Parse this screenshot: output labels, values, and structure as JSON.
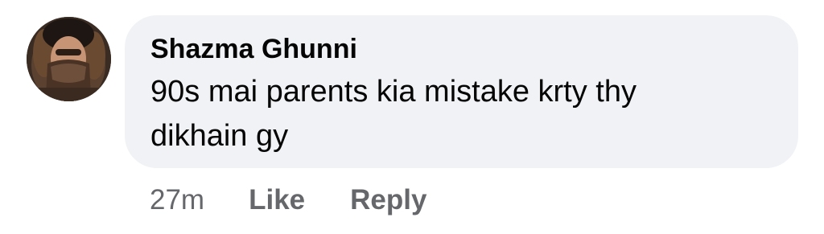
{
  "comment": {
    "author": "Shazma Ghunni",
    "text": "90s mai parents kia mistake krty thy dikhain gy",
    "timestamp": "27m",
    "actions": {
      "like_label": "Like",
      "reply_label": "Reply"
    }
  },
  "colors": {
    "bubble_bg": "#f0f2f5",
    "text": "#050505",
    "secondary_text": "#65676b"
  }
}
